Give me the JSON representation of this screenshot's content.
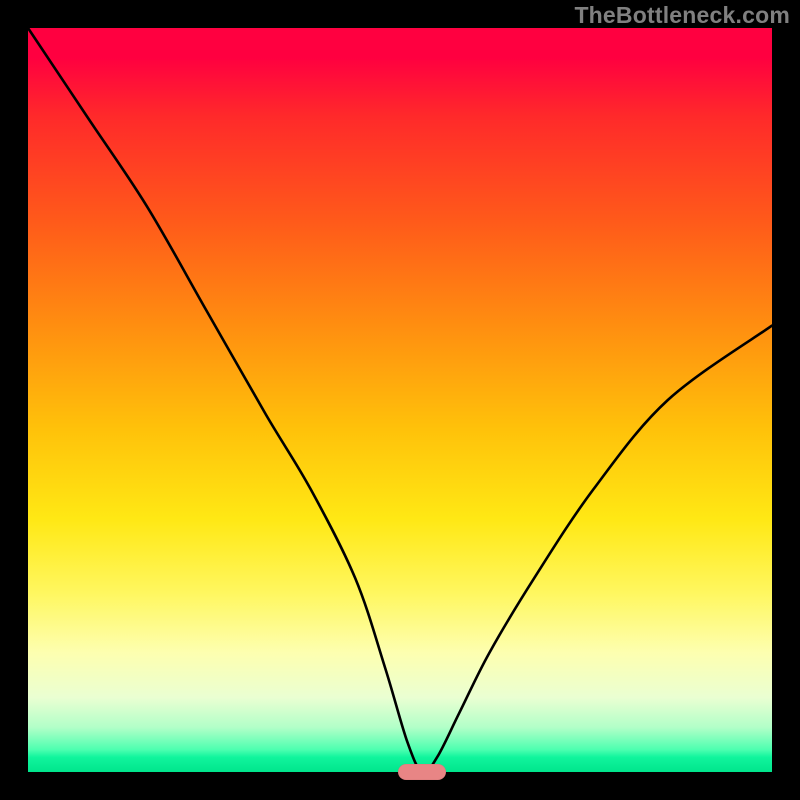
{
  "watermark": "TheBottleneck.com",
  "colors": {
    "background": "#000000",
    "marker": "#e88585",
    "curve": "#000000"
  },
  "chart_data": {
    "type": "line",
    "title": "",
    "xlabel": "",
    "ylabel": "",
    "xlim": [
      0,
      100
    ],
    "ylim": [
      0,
      100
    ],
    "grid": false,
    "legend": false,
    "marker": {
      "x": 53,
      "y": 0,
      "width_pct": 6.5
    },
    "series": [
      {
        "name": "bottleneck-curve",
        "x": [
          0,
          8,
          16,
          24,
          32,
          38,
          44,
          48,
          51,
          53,
          55,
          58,
          62,
          68,
          76,
          86,
          100
        ],
        "y": [
          100,
          88,
          76,
          62,
          48,
          38,
          26,
          14,
          4,
          0,
          2,
          8,
          16,
          26,
          38,
          50,
          60
        ]
      }
    ]
  }
}
